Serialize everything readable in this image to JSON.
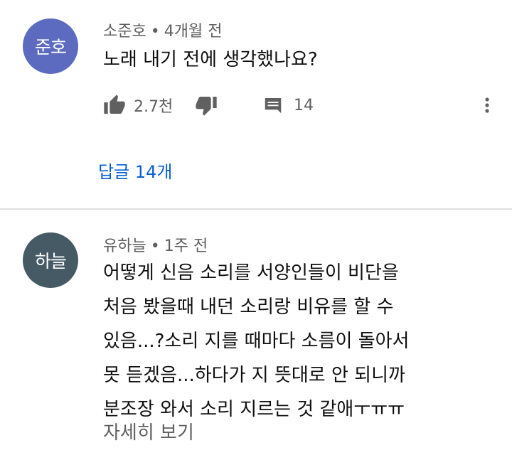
{
  "comments": [
    {
      "avatar_text": "준호",
      "avatar_color": "#5c6bc0",
      "author": "소준호",
      "time": "4개월 전",
      "text_lines": [
        "노래 내기 전에 생각했나요?"
      ],
      "like_count": "2.7천",
      "reply_count": "14",
      "replies_link": "답글 14개",
      "icons": [
        "thumb-up-icon",
        "thumb-down-icon",
        "reply-icon",
        "more-vert-icon"
      ]
    },
    {
      "avatar_text": "하늘",
      "avatar_color": "#455a64",
      "author": "유하늘",
      "time": "1주 전",
      "text_lines": [
        "어떻게 신음 소리를 서양인들이 비단을",
        "처음 봤을때 내던 소리랑 비유를 할 수",
        "있음...?소리 지를 때마다 소름이 돌아서",
        "못 듣겠음...하다가 지 뜻대로 안 되니까",
        "분조장 와서 소리 지르는 것 같애ㅜㅠㅠ"
      ],
      "read_more": "자세히 보기"
    }
  ],
  "separator": "•",
  "colors": {
    "link": "#065fd4",
    "meta": "#606060",
    "icon": "#606060",
    "divider": "#e0e0e0"
  }
}
